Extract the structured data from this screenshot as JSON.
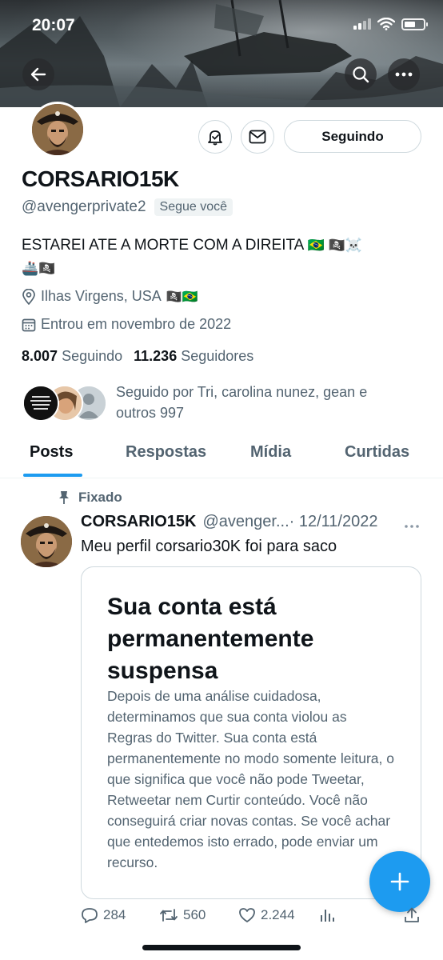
{
  "status_bar": {
    "time": "20:07"
  },
  "profile": {
    "name": "CORSARIO15K",
    "handle": "@avengerprivate2",
    "follows_you": "Segue você",
    "bio_line1": "ESTAREI ATE A MORTE COM A DIREITA",
    "bio_emoji1": "🇧🇷 🏴‍☠️☠️",
    "bio_emoji2": "🚢🏴‍☠️",
    "location": "Ilhas Virgens, USA",
    "location_emoji": "🏴‍☠️🇧🇷",
    "joined": "Entrou em novembro de 2022",
    "following_count": "8.007",
    "following_label": "Seguindo",
    "followers_count": "11.236",
    "followers_label": "Seguidores",
    "followed_by": "Seguido por Tri, carolina nunez, gean e outros 997",
    "follow_button": "Seguindo"
  },
  "tabs": [
    "Posts",
    "Respostas",
    "Mídia",
    "Curtidas"
  ],
  "active_tab": "Posts",
  "pinned_tweet": {
    "pinned_label": "Fixado",
    "author_name": "CORSARIO15K",
    "author_handle": "@avenger...",
    "date": "· 12/11/2022",
    "text": "Meu perfil corsario30K foi para saco",
    "card_title": "Sua conta está permanentemente suspensa",
    "card_body": "Depois de uma análise cuidadosa, determinamos que sua conta violou as Regras do Twitter. Sua conta está permanentemente no modo somente leitura, o que significa que você não pode Tweetar, Retweetar nem Curtir conteúdo. Você não conseguirá criar novas contas. Se você achar que entedemos isto errado, pode enviar um recurso.",
    "replies": "284",
    "retweets": "560",
    "likes": "2.244"
  },
  "colors": {
    "accent": "#1d9bf0",
    "text": "#0f1419",
    "muted": "#536471",
    "border": "#cfd9de"
  },
  "icons": [
    "back-arrow-icon",
    "search-icon",
    "more-icon",
    "notification-bell-icon",
    "mail-icon",
    "location-pin-icon",
    "calendar-icon",
    "pin-icon",
    "reply-icon",
    "retweet-icon",
    "like-icon",
    "analytics-icon",
    "share-icon",
    "compose-plus-icon"
  ]
}
